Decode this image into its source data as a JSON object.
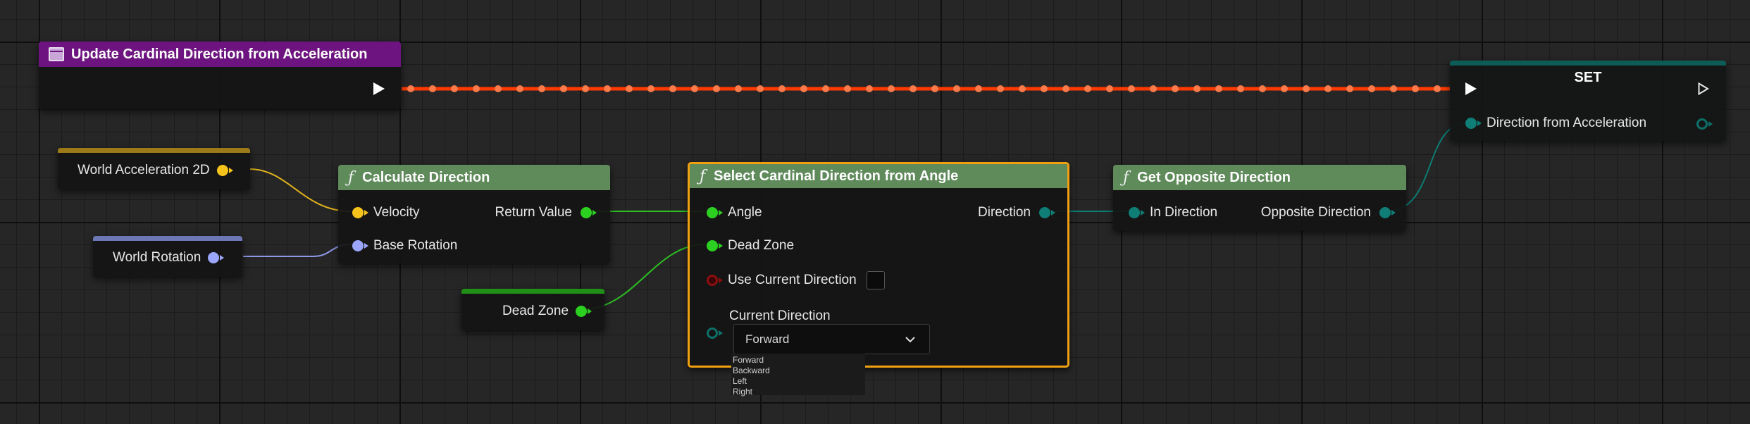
{
  "event_node": {
    "title": "Update Cardinal Direction from Acceleration",
    "header_color": "#6e1480"
  },
  "set_node": {
    "title": "SET",
    "pin_label": "Direction from Acceleration"
  },
  "variables": [
    {
      "label": "World Acceleration 2D",
      "color": "#f6c31a"
    },
    {
      "label": "World Rotation",
      "color": "#9aa6ff"
    },
    {
      "label": "Dead Zone",
      "color": "#2cd021"
    }
  ],
  "calculate_direction": {
    "title": "Calculate Direction",
    "inputs": [
      "Velocity",
      "Base Rotation"
    ],
    "output": "Return Value"
  },
  "select_cardinal": {
    "title": "Select Cardinal Direction from Angle",
    "inputs": [
      "Angle",
      "Dead Zone",
      "Use Current Direction",
      "Current Direction"
    ],
    "output": "Direction",
    "dropdown_value": "Forward",
    "dropdown_options": [
      "Forward",
      "Backward",
      "Left",
      "Right"
    ]
  },
  "get_opposite": {
    "title": "Get Opposite Direction",
    "input": "In Direction",
    "output": "Opposite Direction"
  },
  "colors": {
    "function_header": "#5f8a5a",
    "selected_outline": "#f0a010",
    "exec_wire": "#ff3a00",
    "enum_wire": "#0c7b73"
  },
  "icons": {
    "function": "function-icon",
    "event": "event-icon",
    "exec": "exec-pin-icon",
    "dropdown": "chevron-down-icon"
  }
}
